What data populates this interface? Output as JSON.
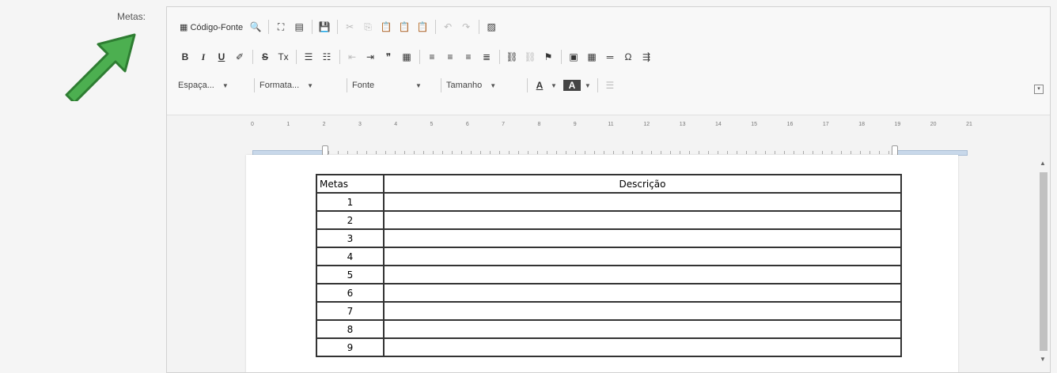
{
  "field": {
    "label": "Metas:"
  },
  "colors": {
    "arrow": "#4caf50",
    "arrow_outline": "#2e7d32",
    "table_border": "#333333"
  },
  "toolbar": {
    "row1": [
      {
        "name": "source-code-button",
        "label": "Código-Fonte",
        "icon": "▦"
      },
      {
        "name": "preview-icon",
        "label": "🔍"
      },
      {
        "name": "maximize-icon",
        "label": "⛶"
      },
      {
        "name": "show-blocks-icon",
        "label": "▤"
      },
      {
        "name": "save-icon",
        "label": "💾"
      },
      {
        "name": "cut-icon",
        "label": "✂"
      },
      {
        "name": "copy-icon",
        "label": "⎘"
      },
      {
        "name": "paste-icon",
        "label": "📋"
      },
      {
        "name": "paste-text-icon",
        "label": "📋"
      },
      {
        "name": "paste-word-icon",
        "label": "📋"
      },
      {
        "name": "undo-icon",
        "label": "↶"
      },
      {
        "name": "redo-icon",
        "label": "↷"
      },
      {
        "name": "spellcheck-icon",
        "label": "▨"
      }
    ],
    "row2": [
      {
        "name": "bold-button",
        "label": "B"
      },
      {
        "name": "italic-button",
        "label": "I"
      },
      {
        "name": "underline-button",
        "label": "U"
      },
      {
        "name": "format-painter-icon",
        "label": "✐"
      },
      {
        "name": "strike-button",
        "label": "S"
      },
      {
        "name": "remove-format-icon",
        "label": "Tx"
      },
      {
        "name": "numbered-list-icon",
        "label": "☰"
      },
      {
        "name": "bulleted-list-icon",
        "label": "☷"
      },
      {
        "name": "outdent-icon",
        "label": "⇤"
      },
      {
        "name": "indent-icon",
        "label": "⇥"
      },
      {
        "name": "blockquote-icon",
        "label": "❞"
      },
      {
        "name": "div-container-icon",
        "label": "▦"
      },
      {
        "name": "align-left-icon",
        "label": "≡"
      },
      {
        "name": "align-center-icon",
        "label": "≡"
      },
      {
        "name": "align-right-icon",
        "label": "≡"
      },
      {
        "name": "justify-icon",
        "label": "≣"
      },
      {
        "name": "link-icon",
        "label": "⛓"
      },
      {
        "name": "unlink-icon",
        "label": "⛓"
      },
      {
        "name": "anchor-flag-icon",
        "label": "⚑"
      },
      {
        "name": "image-icon",
        "label": "▣"
      },
      {
        "name": "table-icon",
        "label": "▦"
      },
      {
        "name": "horizontal-line-icon",
        "label": "═"
      },
      {
        "name": "special-char-icon",
        "label": "Ω"
      },
      {
        "name": "page-break-icon",
        "label": "⇶"
      }
    ],
    "row3": {
      "spacing": "Espaça...",
      "format": "Formata...",
      "font": "Fonte",
      "size": "Tamanho",
      "text_color": "A",
      "bg_color": "A",
      "line_height": "☰",
      "dropdown_arrow": "▼"
    },
    "collapse": "▾"
  },
  "ruler": {
    "numbers": [
      "0",
      "1",
      "2",
      "3",
      "4",
      "5",
      "6",
      "7",
      "8",
      "9",
      "11",
      "12",
      "13",
      "14",
      "15",
      "16",
      "17",
      "18",
      "19",
      "20",
      "21"
    ]
  },
  "table": {
    "headers": [
      "Metas",
      "Descrição"
    ],
    "rows": [
      [
        "1",
        ""
      ],
      [
        "2",
        ""
      ],
      [
        "3",
        ""
      ],
      [
        "4",
        ""
      ],
      [
        "5",
        ""
      ],
      [
        "6",
        ""
      ],
      [
        "7",
        ""
      ],
      [
        "8",
        ""
      ],
      [
        "9",
        ""
      ]
    ]
  },
  "scrollbar": {
    "up": "▲",
    "down": "▼"
  }
}
